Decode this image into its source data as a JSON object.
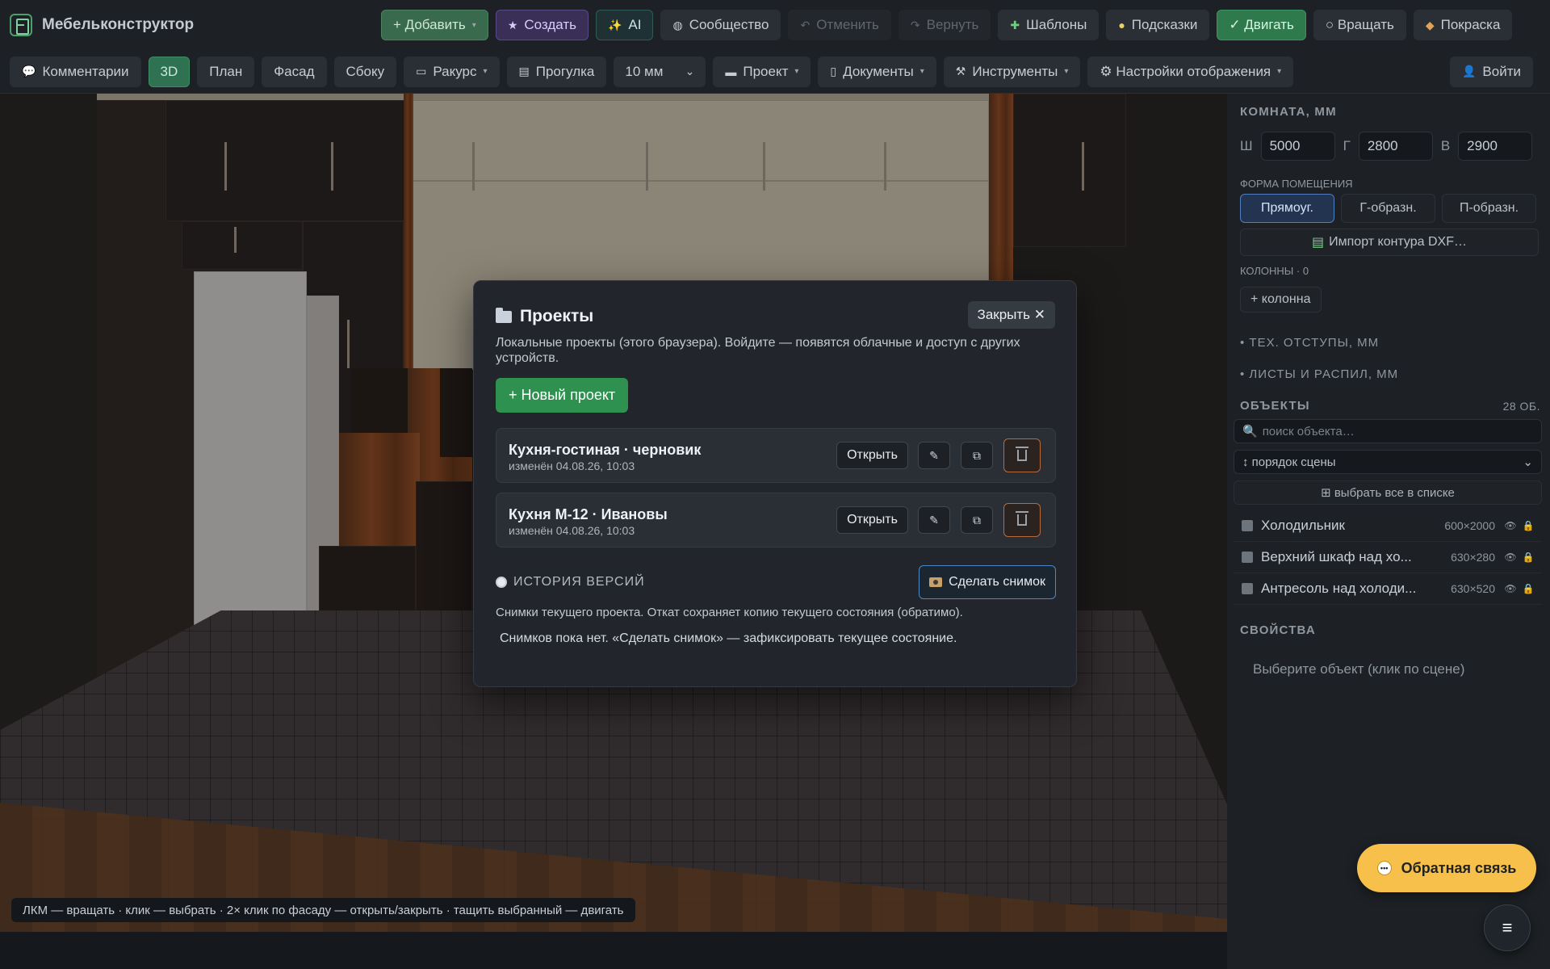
{
  "app": {
    "title": "Мебельконструктор"
  },
  "toolbar": {
    "add": "+ Добавить",
    "create": "Создать",
    "ai": "AI",
    "community": "Сообщество",
    "undo": "Отменить",
    "redo": "Вернуть",
    "templates": "Шаблоны",
    "hints": "Подсказки",
    "move": "✓ Двигать",
    "rotate": "○ Вращать",
    "paint": "Покраска"
  },
  "toolbar2": {
    "comments": "Комментарии",
    "view_3d": "3D",
    "view_plan": "План",
    "view_facade": "Фасад",
    "view_side": "Сбоку",
    "angle": "Ракурс",
    "walk": "Прогулка",
    "step_value": "10 мм",
    "project": "Проект",
    "documents": "Документы",
    "tools": "Инструменты",
    "display_settings": "⚙ Настройки отображения",
    "login": "Войти"
  },
  "viewport": {
    "hint": "ЛКМ — вращать · клик — выбрать · 2× клик по фасаду — открыть/закрыть · тащить выбранный — двигать"
  },
  "panel": {
    "room_title": "КОМНАТА, ММ",
    "width_label": "Ш",
    "width_value": "5000",
    "depth_label": "Г",
    "depth_value": "2800",
    "height_label": "В",
    "height_value": "2900",
    "shape_label": "ФОРМА ПОМЕЩЕНИЯ",
    "shape_rect": "Прямоуг.",
    "shape_l": "Г-образн.",
    "shape_u": "П-образн.",
    "import_dxf": "Импорт контура DXF…",
    "columns_label": "КОЛОННЫ · 0",
    "add_column": "+ колонна",
    "tech_offsets": "• ТЕХ. ОТСТУПЫ, ММ",
    "sheets": "• ЛИСТЫ И РАСПИЛ, ММ",
    "objects_title": "ОБЪЕКТЫ",
    "objects_count": "28 ОБ.",
    "search_placeholder": "поиск объекта…",
    "order": "↕ порядок сцены",
    "select_all": "⊞ выбрать все в списке",
    "objects": [
      {
        "name": "Холодильник",
        "size": "600×2000"
      },
      {
        "name": "Верхний шкаф над хо...",
        "size": "630×280"
      },
      {
        "name": "Антресоль над холоди...",
        "size": "630×520"
      }
    ],
    "props_title": "СВОЙСТВА",
    "props_hint": "Выберите объект (клик по сцене)"
  },
  "feedback": {
    "label": "Обратная связь"
  },
  "modal": {
    "title": "Проекты",
    "close": "Закрыть ✕",
    "description": "Локальные проекты (этого браузера). Войдите — появятся облачные и доступ с других устройств.",
    "new_project": "+ Новый проект",
    "projects": [
      {
        "name": "Кухня-гостиная · черновик",
        "modified": "изменён 04.08.26, 10:03",
        "open": "Открыть"
      },
      {
        "name": "Кухня М-12 · Ивановы",
        "modified": "изменён 04.08.26, 10:03",
        "open": "Открыть"
      }
    ],
    "history_title": "ИСТОРИЯ ВЕРСИЙ",
    "snapshot_button": "Сделать снимок",
    "history_note": "Снимки текущего проекта. Откат сохраняет копию текущего состояния (обратимо).",
    "history_empty": "Снимков пока нет. «Сделать снимок» — зафиксировать текущее состояние."
  },
  "colors": {
    "accent_green": "#2f9150",
    "feedback_yellow": "#f6c04b",
    "snapshot_border": "#4e88c2",
    "delete_border": "#b86a3a"
  }
}
